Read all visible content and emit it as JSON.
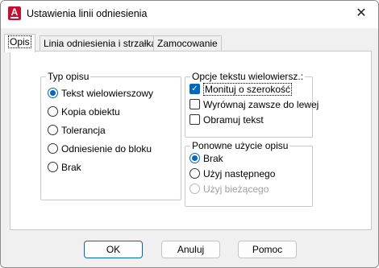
{
  "window": {
    "title": "Ustawienia linii odniesienia",
    "app_icon_glyph": "A",
    "close_glyph": "✕"
  },
  "tabs": [
    {
      "label": "Opis",
      "active": true
    },
    {
      "label": "Linia odniesienia i strzałka",
      "active": false
    },
    {
      "label": "Zamocowanie",
      "active": false
    }
  ],
  "annotation_type": {
    "legend": "Typ opisu",
    "options": [
      {
        "label": "Tekst wielowierszowy",
        "selected": true
      },
      {
        "label": "Kopia obiektu",
        "selected": false
      },
      {
        "label": "Tolerancja",
        "selected": false
      },
      {
        "label": "Odniesienie do bloku",
        "selected": false
      },
      {
        "label": "Brak",
        "selected": false
      }
    ]
  },
  "mtext_options": {
    "legend": "Opcje tekstu wielowiersz.:",
    "checkboxes": [
      {
        "label": "Monituj o szerokość",
        "checked": true
      },
      {
        "label": "Wyrównaj zawsze do lewej",
        "checked": false
      },
      {
        "label": "Obramuj tekst",
        "checked": false
      }
    ]
  },
  "annotation_reuse": {
    "legend": "Ponowne użycie opisu",
    "options": [
      {
        "label": "Brak",
        "selected": true,
        "disabled": false
      },
      {
        "label": "Użyj następnego",
        "selected": false,
        "disabled": false
      },
      {
        "label": "Użyj bieżącego",
        "selected": false,
        "disabled": true
      }
    ]
  },
  "buttons": {
    "ok": "OK",
    "cancel": "Anuluj",
    "help": "Pomoc"
  },
  "colors": {
    "accent": "#0067c0",
    "app_icon": "#c8102e"
  }
}
